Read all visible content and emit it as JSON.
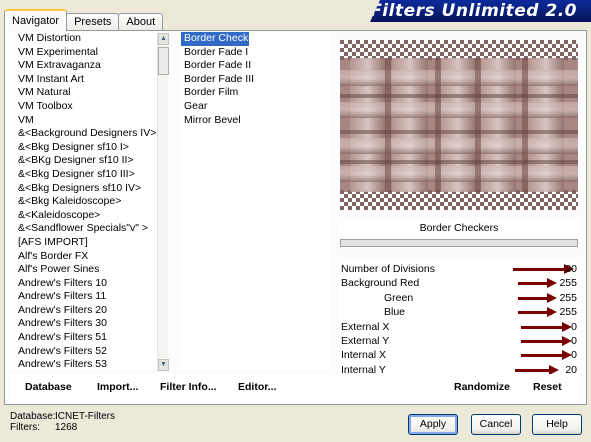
{
  "tabs": [
    "Navigator",
    "Presets",
    "About"
  ],
  "app_title": "Filters Unlimited 2.0",
  "categories": [
    "VM Distortion",
    "VM Experimental",
    "VM Extravaganza",
    "VM Instant Art",
    "VM Natural",
    "VM Toolbox",
    "VM",
    "&<Background Designers IV>",
    "&<Bkg Designer sf10 I>",
    "&<BKg Designer sf10 II>",
    "&<Bkg Designer sf10 III>",
    "&<Bkg Designers sf10 IV>",
    "&<Bkg Kaleidoscope>",
    "&<Kaleidoscope>",
    "&<Sandflower Specials\"v\" >",
    "[AFS IMPORT]",
    "Alf's Border FX",
    "Alf's Power Sines",
    "Andrew's Filters 10",
    "Andrew's Filters 11",
    "Andrew's Filters 20",
    "Andrew's Filters 30",
    "Andrew's Filters 51",
    "Andrew's Filters 52",
    "Andrew's Filters 53"
  ],
  "filters": [
    "Border Checkers",
    "Border Fade I",
    "Border Fade II",
    "Border Fade III",
    "Border Film",
    "Gear",
    "Mirror Bevel"
  ],
  "selected_filter": "Border Checkers",
  "progress": 0.0,
  "params": [
    {
      "label": "Number of Divisions",
      "value": "30",
      "indent": false
    },
    {
      "label": "Background Red",
      "value": "255",
      "indent": false
    },
    {
      "label": "Green",
      "value": "255",
      "indent": true
    },
    {
      "label": "Blue",
      "value": "255",
      "indent": true
    },
    {
      "label": "External X",
      "value": "0",
      "indent": false
    },
    {
      "label": "External Y",
      "value": "0",
      "indent": false
    },
    {
      "label": "Internal X",
      "value": "0",
      "indent": false
    },
    {
      "label": "Internal Y",
      "value": "20",
      "indent": false
    }
  ],
  "actions": {
    "database": "Database",
    "import": "Import...",
    "filter_info": "Filter Info...",
    "editor": "Editor...",
    "randomize": "Randomize",
    "reset": "Reset"
  },
  "footer": {
    "database_label": "Database:",
    "database_value": "ICNET-Filters",
    "filters_label": "Filters:",
    "filters_value": "1268"
  },
  "buttons": {
    "apply": "Apply",
    "cancel": "Cancel",
    "help": "Help"
  },
  "colors": {
    "accent": "#316ac5",
    "arrow": "#7a0000",
    "banner": "#0d2a9b",
    "preview_mauve": "#a88682"
  }
}
